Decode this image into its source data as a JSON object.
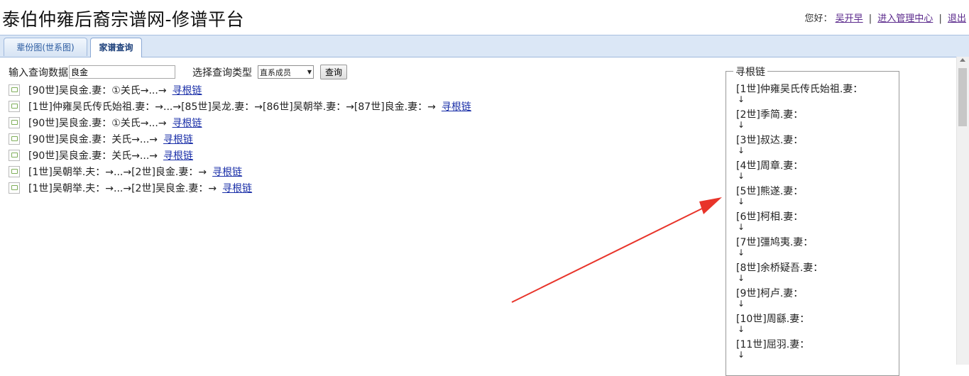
{
  "header": {
    "title": "泰伯仲雍后裔宗谱网-修谱平台",
    "greeting": "您好：",
    "username": "吴开早",
    "admin_link": "进入管理中心",
    "logout": "退出",
    "separator": "|"
  },
  "tabs": [
    {
      "label": "辈份图(世系图)"
    },
    {
      "label": "家谱查询"
    }
  ],
  "query": {
    "input_label": "输入查询数据",
    "input_value": "良金",
    "type_label": "选择查询类型",
    "type_selected": "直系成员",
    "button": "查询"
  },
  "results": [
    {
      "text": "[90世]吴良金.妻：①关氏→...→",
      "link": "寻根链"
    },
    {
      "text": "[1世]仲雍吴氏传氏始祖.妻：→...→[85世]吴龙.妻：→[86世]吴朝举.妻：→[87世]良金.妻：→",
      "link": "寻根链"
    },
    {
      "text": "[90世]吴良金.妻：①关氏→...→",
      "link": "寻根链"
    },
    {
      "text": "[90世]吴良金.妻：关氏→...→",
      "link": "寻根链"
    },
    {
      "text": "[90世]吴良金.妻：关氏→...→",
      "link": "寻根链"
    },
    {
      "text": "[1世]吴朝举.夫：→...→[2世]良金.妻：→",
      "link": "寻根链"
    },
    {
      "text": "[1世]吴朝举.夫：→...→[2世]吴良金.妻：→",
      "link": "寻根链"
    }
  ],
  "chain": {
    "title": "寻根链",
    "arrow_glyph": "↓",
    "items": [
      "[1世]仲雍吴氏传氏始祖.妻：",
      "[2世]季简.妻：",
      "[3世]叔达.妻：",
      "[4世]周章.妻：",
      "[5世]熊遂.妻：",
      "[6世]柯相.妻：",
      "[7世]彊鸠夷.妻：",
      "[8世]余桥疑吾.妻：",
      "[9世]柯卢.妻：",
      "[10世]周繇.妻：",
      "[11世]屈羽.妻："
    ]
  },
  "annotation": {
    "color": "#e8342a"
  }
}
